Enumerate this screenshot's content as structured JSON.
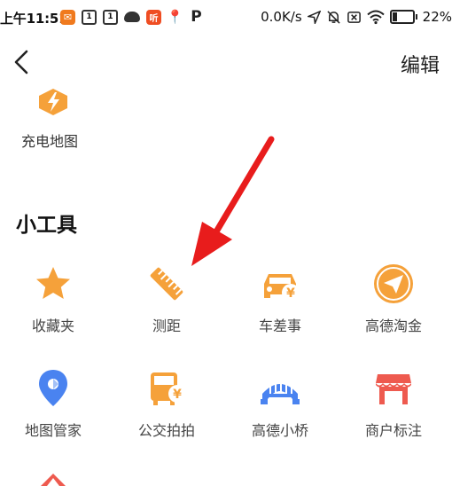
{
  "status_bar": {
    "time": "上午11:51",
    "notification_badge_1": "1",
    "notification_badge_2": "1",
    "ting_badge": "听",
    "p_icon": "P",
    "network_speed": "0.0K/s",
    "battery_percent": "22%",
    "battery_level": 0.22
  },
  "top_bar": {
    "edit_label": "编辑"
  },
  "partial_item": {
    "label": "充电地图"
  },
  "tools": {
    "title": "小工具",
    "items": [
      {
        "label": "收藏夹",
        "icon": "star-icon"
      },
      {
        "label": "测距",
        "icon": "ruler-icon"
      },
      {
        "label": "车差事",
        "icon": "car-service-icon"
      },
      {
        "label": "高德淘金",
        "icon": "paper-plane-icon"
      },
      {
        "label": "地图管家",
        "icon": "map-pin-icon"
      },
      {
        "label": "公交拍拍",
        "icon": "bus-icon"
      },
      {
        "label": "高德小桥",
        "icon": "bridge-icon"
      },
      {
        "label": "商户标注",
        "icon": "shop-icon"
      }
    ]
  },
  "colors": {
    "orange": "#f5a13a",
    "blue": "#4a83f0",
    "red": "#ee5a4f",
    "arrow": "#e81c1c"
  }
}
